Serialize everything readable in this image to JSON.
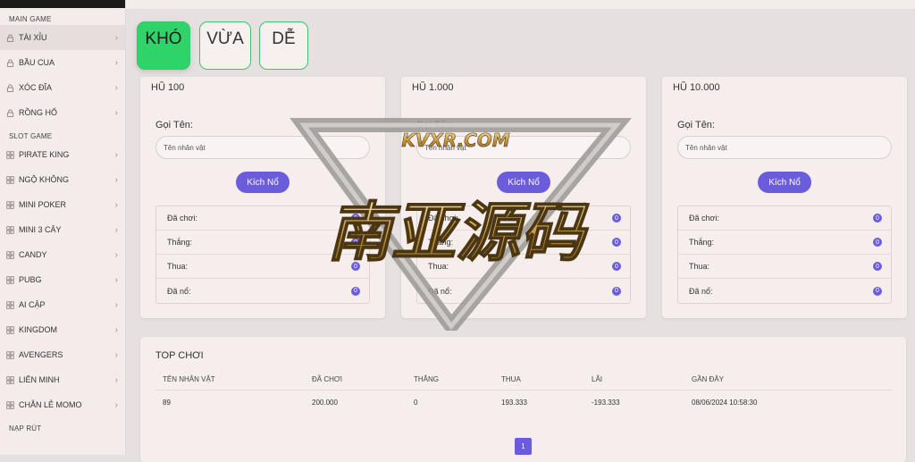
{
  "sidebar": {
    "sections": [
      {
        "title": "MAIN GAME",
        "items": [
          {
            "label": "TÀI XỈU",
            "icon": "lock-icon",
            "active": true
          },
          {
            "label": "BẦU CUA",
            "icon": "lock-icon"
          },
          {
            "label": "XÓC ĐĨA",
            "icon": "lock-icon"
          },
          {
            "label": "RỒNG HỔ",
            "icon": "lock-icon"
          }
        ]
      },
      {
        "title": "SLOT GAME",
        "items": [
          {
            "label": "PIRATE KING",
            "icon": "grid-icon"
          },
          {
            "label": "NGỘ KHÔNG",
            "icon": "grid-icon"
          },
          {
            "label": "MINI POKER",
            "icon": "grid-icon"
          },
          {
            "label": "MINI 3 CÂY",
            "icon": "grid-icon"
          },
          {
            "label": "CANDY",
            "icon": "grid-icon"
          },
          {
            "label": "PUBG",
            "icon": "grid-icon"
          },
          {
            "label": "AI CẬP",
            "icon": "grid-icon"
          },
          {
            "label": "KINGDOM",
            "icon": "grid-icon"
          },
          {
            "label": "AVENGERS",
            "icon": "grid-icon"
          },
          {
            "label": "LIÊN MINH",
            "icon": "grid-icon"
          },
          {
            "label": "CHẴN LẺ MOMO",
            "icon": "grid-icon"
          }
        ]
      },
      {
        "title": "NẠP RÚT",
        "items": []
      }
    ]
  },
  "difficulty": {
    "tabs": [
      "KHÓ",
      "VỪA",
      "DỄ"
    ],
    "selected": "KHÓ"
  },
  "jackpots": [
    {
      "title": "HŨ 100",
      "name_label": "Gọi Tên:",
      "name_placeholder": "Tên nhân vật",
      "button": "Kích Nổ",
      "stats": [
        {
          "label": "Đã chơi:",
          "value": "0"
        },
        {
          "label": "Thắng:",
          "value": "0"
        },
        {
          "label": "Thua:",
          "value": "0"
        },
        {
          "label": "Đã nổ:",
          "value": "0"
        }
      ]
    },
    {
      "title": "HŨ 1.000",
      "name_label": "Gọi Tên:",
      "name_placeholder": "Tên nhân vật",
      "button": "Kích Nổ",
      "stats": [
        {
          "label": "Đã chơi:",
          "value": "0"
        },
        {
          "label": "Thắng:",
          "value": "0"
        },
        {
          "label": "Thua:",
          "value": "0"
        },
        {
          "label": "Đã nổ:",
          "value": "0"
        }
      ]
    },
    {
      "title": "HŨ 10.000",
      "name_label": "Gọi Tên:",
      "name_placeholder": "Tên nhân vật",
      "button": "Kích Nổ",
      "stats": [
        {
          "label": "Đã chơi:",
          "value": "0"
        },
        {
          "label": "Thắng:",
          "value": "0"
        },
        {
          "label": "Thua:",
          "value": "0"
        },
        {
          "label": "Đã nổ:",
          "value": "0"
        }
      ]
    }
  ],
  "top_players": {
    "title": "TOP CHƠI",
    "columns": [
      "TÊN NHÂN VẬT",
      "ĐÃ CHƠI",
      "THẮNG",
      "THUA",
      "LÃI",
      "GẦN ĐÂY"
    ],
    "rows": [
      [
        "89",
        "200.000",
        "0",
        "193.333",
        "-193.333",
        "08/06/2024 10:58:30"
      ]
    ],
    "page": "1"
  },
  "watermark": {
    "site": "KVXR.COM",
    "chinese": "南亚源码"
  },
  "colors": {
    "accent": "#6b5cdc",
    "active_tab": "#2ed46a",
    "tab_border": "#3cc46a"
  }
}
